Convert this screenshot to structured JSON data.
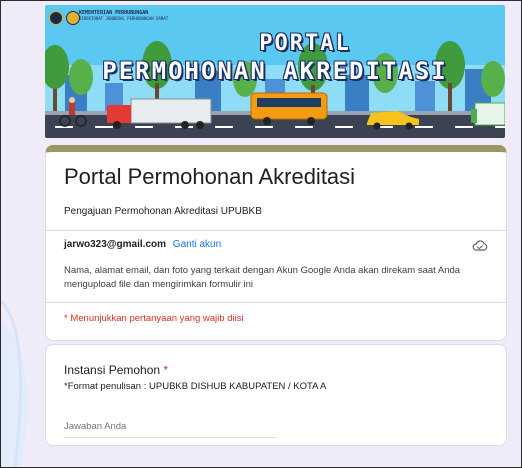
{
  "banner": {
    "ministry_line1": "KEMENTERIAN PERHUBUNGAN",
    "ministry_line2": "DIREKTORAT JENDERAL PERHUBUNGAN DARAT",
    "title_line1": "PORTAL",
    "title_line2": "PERMOHONAN AKREDITASI"
  },
  "form": {
    "title": "Portal Permohonan Akreditasi",
    "description": "Pengajuan Permohonan Akreditasi UPUBKB",
    "account_email": "jarwo323@gmail.com",
    "switch_account": "Ganti akun",
    "privacy_note": "Nama, alamat email, dan foto yang terkait dengan Akun Google Anda akan direkam saat Anda mengupload file dan mengirimkan formulir ini",
    "required_note": "* Menunjukkan pertanyaan yang wajib diisi"
  },
  "question": {
    "title": "Instansi Pemohon",
    "required_mark": "*",
    "help": "*Format penulisan : UPUBKB DISHUB KABUPATEN / KOTA A",
    "placeholder": "Jawaban Anda"
  },
  "colors": {
    "header_accent": "#9c9766",
    "link": "#1a73e8",
    "required": "#d93025",
    "background": "#f0ebf8"
  },
  "icons": [
    "cloud-icon"
  ]
}
